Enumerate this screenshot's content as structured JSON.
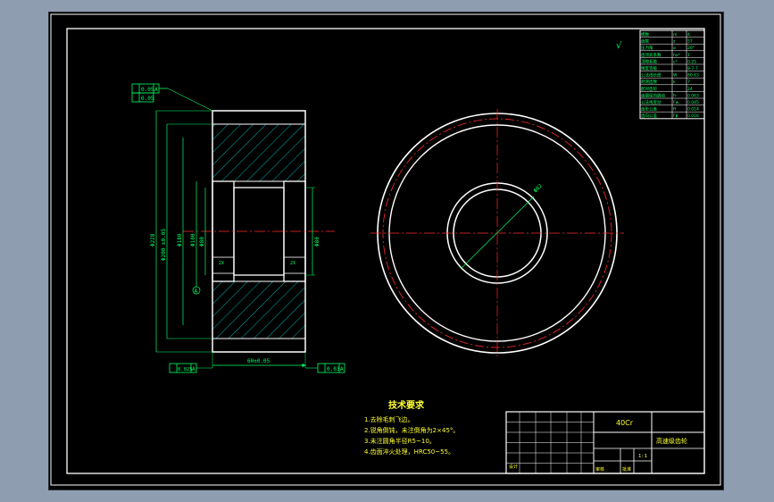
{
  "colors": {
    "background": "#000000",
    "frame": "#ffffff",
    "dimension": "#00ff66",
    "centerline": "#ff2a2a",
    "hatch": "#00e0e0",
    "tech_text": "#ffff33",
    "canvas_bg": "#8e9db0"
  },
  "roughness_symbol": "√",
  "side_view": {
    "tolerance_frames": [
      {
        "sym": "↗",
        "value": "0.05",
        "datum": "A"
      },
      {
        "sym": "⌖",
        "value": "0.05",
        "datum": ""
      },
      {
        "sym": "↗",
        "value": "0.025",
        "datum": "A"
      },
      {
        "sym": "↗",
        "value": "0.03",
        "datum": "A"
      }
    ],
    "dims": {
      "outer_dia": "Φ228",
      "tip_dia": "Φ200 ±0.05",
      "root_dia": "Φ180",
      "bore_left": "Φ80",
      "bore_right": "Φ80",
      "hub_dia": "Φ100",
      "face_width": "60±0.05",
      "chamfer_left": "2X",
      "chamfer_right": "2X"
    },
    "datum_label": "A"
  },
  "front_view": {
    "dim_label": "Φ82"
  },
  "tech_requirements": {
    "title": "技术要求",
    "items": [
      "1.去除毛刺飞边。",
      "2.锐角倒钝，未注倒角为2×45°。",
      "3.未注圆角半径R5~10。",
      "4.齿面淬火处理，HRC50~55。"
    ]
  },
  "gear_param_table": {
    "rows": [
      [
        "模数",
        "m",
        "4"
      ],
      [
        "齿数",
        "z",
        "57"
      ],
      [
        "压力角",
        "α",
        "20°"
      ],
      [
        "齿顶高系数",
        "ha*",
        "1"
      ],
      [
        "顶隙系数",
        "c*",
        "0.25"
      ],
      [
        "精度等级",
        "",
        "8-7-7"
      ],
      [
        "公法线长度",
        "W",
        "80.63"
      ],
      [
        "跨测齿数",
        "k",
        "7"
      ],
      [
        "配对齿轮",
        "",
        "24"
      ],
      [
        "齿圈径向跳动",
        "Fr",
        "0.063"
      ],
      [
        "公法线变动",
        "Fw",
        "0.045"
      ],
      [
        "齿形公差",
        "ff",
        "0.014"
      ],
      [
        "齿向公差",
        "Fβ",
        "0.016"
      ]
    ]
  },
  "title_block": {
    "material": "40Cr",
    "drawing_name": "高速级齿轮",
    "school": "图号",
    "scale": "1:1",
    "designer": "设计",
    "checker": "审核",
    "approver": "批准",
    "sheet": "共 张 第 张"
  }
}
